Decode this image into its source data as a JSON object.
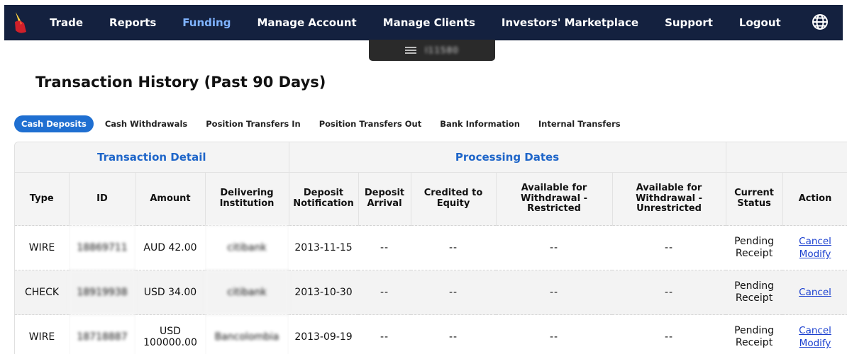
{
  "nav": {
    "items": [
      "Trade",
      "Reports",
      "Funding",
      "Manage Account",
      "Manage Clients",
      "Investors' Marketplace",
      "Support",
      "Logout"
    ],
    "active_index": 2
  },
  "account_handle": {
    "account_id": "I11580"
  },
  "page_title": "Transaction History (Past 90 Days)",
  "tabs": [
    "Cash Deposits",
    "Cash Withdrawals",
    "Position Transfers In",
    "Position Transfers Out",
    "Bank Information",
    "Internal Transfers"
  ],
  "active_tab": 0,
  "table": {
    "groups": [
      "Transaction Detail",
      "Processing Dates"
    ],
    "columns": [
      "Type",
      "ID",
      "Amount",
      "Delivering Institution",
      "Deposit Notification",
      "Deposit Arrival",
      "Credited to Equity",
      "Available for Withdrawal - Restricted",
      "Available for Withdrawal - Unrestricted",
      "Current Status",
      "Action"
    ],
    "rows": [
      {
        "type": "WIRE",
        "id": "18869711",
        "amount": "AUD 42.00",
        "institution": "citibank",
        "notification": "2013-11-15",
        "arrival": "--",
        "credited": "--",
        "restricted": "--",
        "unrestricted": "--",
        "status": "Pending Receipt",
        "actions": [
          "Cancel",
          "Modify"
        ]
      },
      {
        "type": "CHECK",
        "id": "18919938",
        "amount": "USD 34.00",
        "institution": "citibank",
        "notification": "2013-10-30",
        "arrival": "--",
        "credited": "--",
        "restricted": "--",
        "unrestricted": "--",
        "status": "Pending Receipt",
        "actions": [
          "Cancel"
        ]
      },
      {
        "type": "WIRE",
        "id": "18718887",
        "amount": "USD 100000.00",
        "institution": "Bancolombia",
        "notification": "2013-09-19",
        "arrival": "--",
        "credited": "--",
        "restricted": "--",
        "unrestricted": "--",
        "status": "Pending Receipt",
        "actions": [
          "Cancel",
          "Modify"
        ]
      }
    ]
  },
  "colors": {
    "nav_bg": "#14213f",
    "active_tab": "#1f6fd1",
    "group_header": "#1f66c9",
    "link": "#1a3fcf"
  }
}
